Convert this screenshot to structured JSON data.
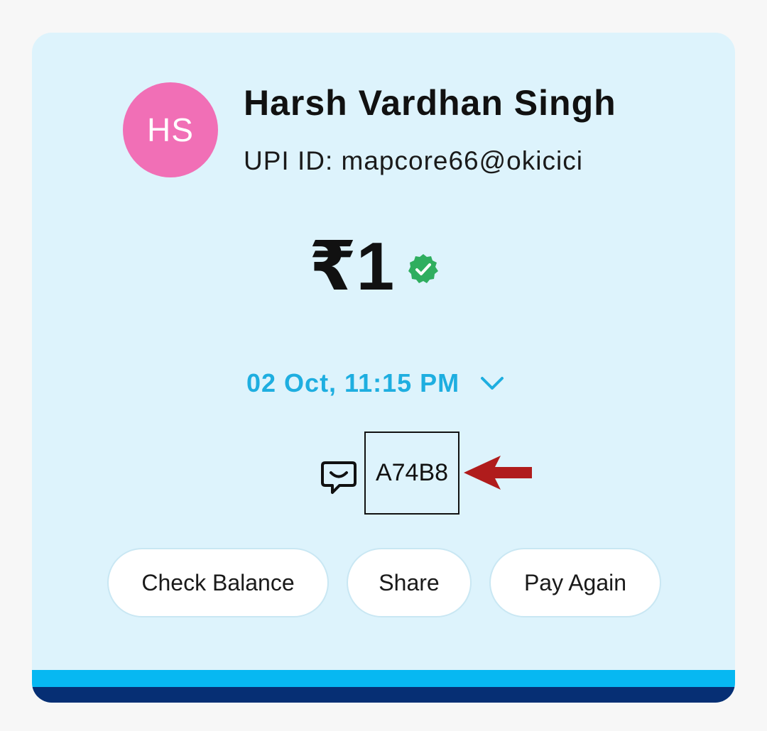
{
  "payee": {
    "initials": "HS",
    "name": "Harsh Vardhan Singh",
    "upi_id": "UPI ID: mapcore66@okicici"
  },
  "amount": "₹1",
  "date": "02 Oct, 11:15 PM",
  "note": "A74B8",
  "actions": {
    "check_balance": "Check Balance",
    "share": "Share",
    "pay_again": "Pay Again"
  },
  "colors": {
    "card_bg": "#ddf3fc",
    "avatar": "#f16fb6",
    "accent_blue": "#1eaee0",
    "verified_green": "#2fae5f",
    "arrow_red": "#b01c1c",
    "stripe_light": "#07b8f2",
    "stripe_dark": "#062f74"
  },
  "icons": [
    "verified-badge-icon",
    "chevron-down-icon",
    "message-icon",
    "arrow-left-icon"
  ]
}
